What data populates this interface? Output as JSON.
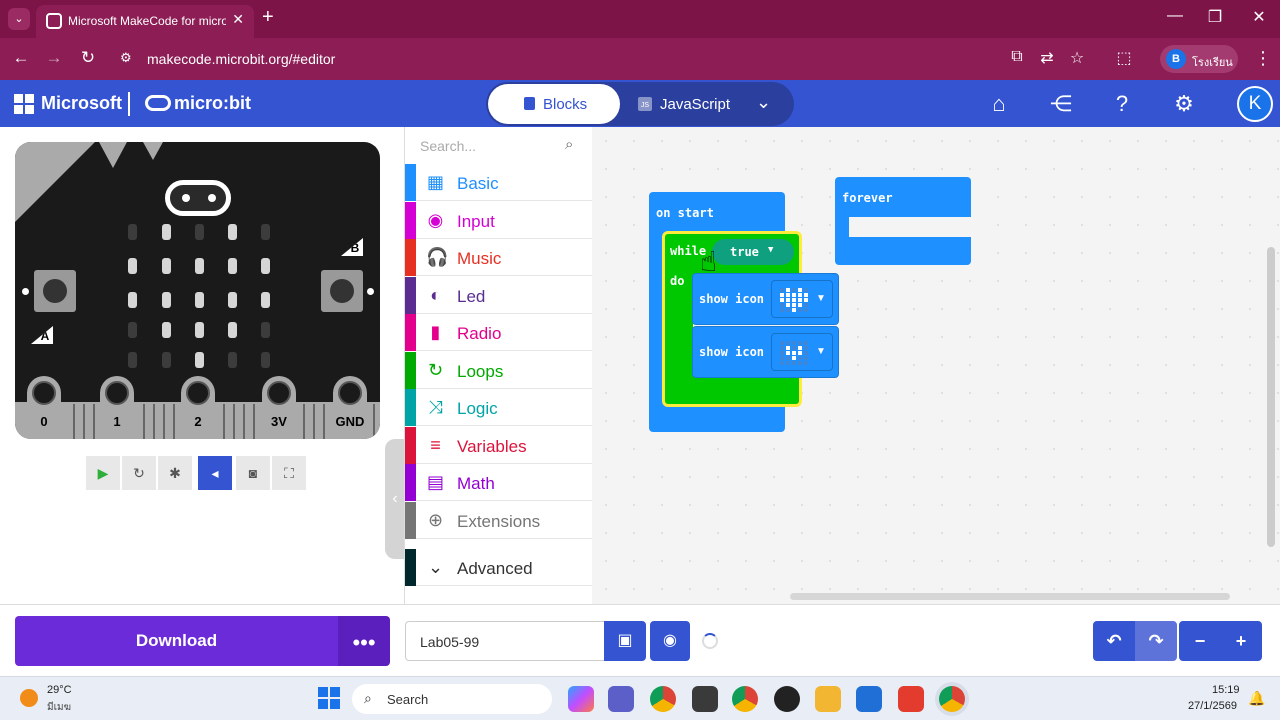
{
  "browser": {
    "tab_title": "Microsoft MakeCode for micro:bit",
    "tab_close": "✕",
    "new_tab": "+",
    "url": "makecode.microbit.org/#editor",
    "profile_initial": "B",
    "profile_name": "โรงเรียน"
  },
  "header": {
    "microsoft_label": "Microsoft",
    "microbit_label": "micro:bit",
    "blocks_label": "Blocks",
    "javascript_label": "JavaScript",
    "user_initial": "K",
    "accent_color": "#3454d1"
  },
  "simulator": {
    "button_a": "A",
    "button_b": "B",
    "pins": [
      "0",
      "1",
      "2",
      "3V",
      "GND"
    ],
    "led_matrix": [
      [
        0,
        1,
        0,
        1,
        0
      ],
      [
        1,
        1,
        1,
        1,
        1
      ],
      [
        1,
        1,
        1,
        1,
        1
      ],
      [
        0,
        1,
        1,
        1,
        0
      ],
      [
        0,
        0,
        1,
        0,
        0
      ]
    ]
  },
  "toolbox": {
    "search_placeholder": "Search...",
    "categories": [
      {
        "label": "Basic",
        "color": "#1e90ff",
        "icon": "grid-icon"
      },
      {
        "label": "Input",
        "color": "#d400d4",
        "icon": "target-icon"
      },
      {
        "label": "Music",
        "color": "#e63022",
        "icon": "headphones-icon"
      },
      {
        "label": "Led",
        "color": "#5c2d91",
        "icon": "toggle-icon"
      },
      {
        "label": "Radio",
        "color": "#e3008c",
        "icon": "signal-bars-icon"
      },
      {
        "label": "Loops",
        "color": "#00aa00",
        "icon": "refresh-icon"
      },
      {
        "label": "Logic",
        "color": "#00a4a6",
        "icon": "shuffle-icon"
      },
      {
        "label": "Variables",
        "color": "#dc143c",
        "icon": "list-icon"
      },
      {
        "label": "Math",
        "color": "#9400d3",
        "icon": "calculator-icon"
      },
      {
        "label": "Extensions",
        "color": "#757575",
        "icon": "plus-circle-icon"
      },
      {
        "label": "Advanced",
        "color": "#00272b",
        "icon": "chevron-down-icon"
      }
    ]
  },
  "workspace": {
    "on_start": "on start",
    "while_label": "while",
    "true_label": "true",
    "do_label": "do",
    "show_icon_1": "show icon",
    "show_icon_2": "show icon",
    "forever_label": "forever",
    "heart_large": [
      [
        0,
        1,
        0,
        1,
        0
      ],
      [
        1,
        1,
        1,
        1,
        1
      ],
      [
        1,
        1,
        1,
        1,
        1
      ],
      [
        0,
        1,
        1,
        1,
        0
      ],
      [
        0,
        0,
        1,
        0,
        0
      ]
    ],
    "heart_small": [
      [
        0,
        0,
        0,
        0,
        0
      ],
      [
        0,
        1,
        0,
        1,
        0
      ],
      [
        0,
        1,
        1,
        1,
        0
      ],
      [
        0,
        0,
        1,
        0,
        0
      ],
      [
        0,
        0,
        0,
        0,
        0
      ]
    ]
  },
  "bottom": {
    "download_label": "Download",
    "more_label": "•••",
    "project_name": "Lab05-99"
  },
  "taskbar": {
    "temperature": "29°C",
    "weather_desc": "มีเมฆ",
    "search_label": "Search",
    "time": "15:19",
    "date": "27/1/2569"
  }
}
